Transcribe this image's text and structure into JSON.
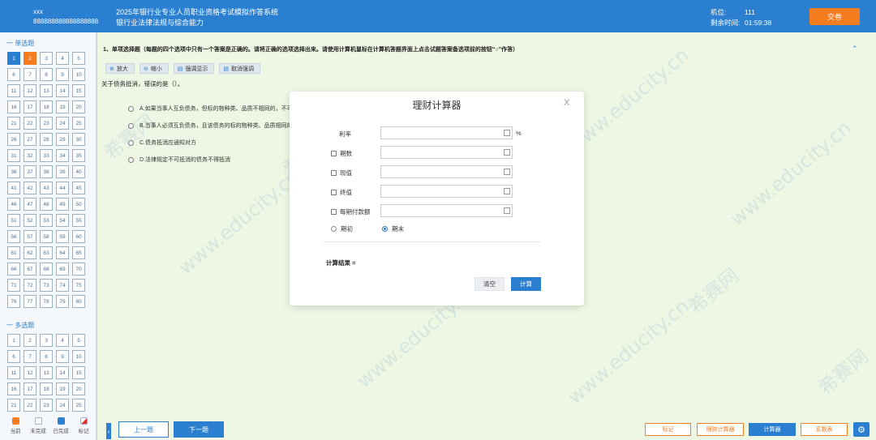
{
  "header": {
    "candidate_name": "xxx",
    "candidate_id": "888888888888888888",
    "exam_title": "2025年银行业专业人员职业资格考试模拟作答系统",
    "exam_subject": "银行业法律法规与综合能力",
    "seat_label": "机位:",
    "seat_value": "111",
    "time_label": "剩余时间:",
    "time_value": "01:59:38",
    "submit_label": "交卷"
  },
  "sidebar": {
    "single_title": "一 单选题",
    "multi_title": "一 多选题",
    "single_questions": [
      "1",
      "2",
      "3",
      "4",
      "5",
      "6",
      "7",
      "8",
      "9",
      "10",
      "11",
      "12",
      "13",
      "14",
      "15",
      "16",
      "17",
      "18",
      "19",
      "20",
      "21",
      "22",
      "23",
      "24",
      "25",
      "26",
      "27",
      "28",
      "29",
      "30",
      "31",
      "32",
      "33",
      "34",
      "35",
      "36",
      "37",
      "38",
      "39",
      "40",
      "41",
      "42",
      "43",
      "44",
      "45",
      "46",
      "47",
      "48",
      "49",
      "50",
      "51",
      "52",
      "53",
      "54",
      "55",
      "56",
      "57",
      "58",
      "59",
      "60",
      "61",
      "62",
      "63",
      "64",
      "65",
      "66",
      "67",
      "68",
      "69",
      "70",
      "71",
      "72",
      "73",
      "74",
      "75",
      "76",
      "77",
      "78",
      "79",
      "80"
    ],
    "multi_questions": [
      "1",
      "2",
      "3",
      "4",
      "5",
      "6",
      "7",
      "8",
      "9",
      "10",
      "11",
      "12",
      "13",
      "14",
      "15",
      "16",
      "17",
      "18",
      "19",
      "20",
      "21",
      "22",
      "23",
      "24",
      "25"
    ],
    "legend": [
      {
        "label": "当前",
        "color": "#f57c1f"
      },
      {
        "label": "未完成",
        "color": "#ffffff"
      },
      {
        "label": "已完成",
        "color": "#2a7fd0"
      },
      {
        "label": "标记",
        "color": "#e03030"
      }
    ]
  },
  "question": {
    "instruction": "1、单项选择题（每题的四个选项中只有一个答案是正确的。请将正确的选项选择出来。请使用计算机鼠标在计算机答题界面上点击试题答案备选项前的按钮“○”作答）",
    "stem": "关于债务抵消，错误的是（）。",
    "options": [
      "A.如果当事人互负债务，但标的物种类、品质不相同的，不可",
      "B.当事人必须互负债务，且该债务的标的物种类、品质相同的",
      "C.债务抵消应通知对方",
      "D.法律规定不可抵消的债务不得抵消"
    ]
  },
  "toolbar": {
    "zoom_in": "放大",
    "zoom_out": "缩小",
    "highlight": "强调显示",
    "cancel_highlight": "取消强调"
  },
  "navigation": {
    "prev": "上一题",
    "next": "下一题"
  },
  "bottom_buttons": {
    "mark": "标记",
    "fin_calc": "理财计算器",
    "calc": "计算器",
    "coef_table": "系数表"
  },
  "calculator": {
    "title": "理财计算器",
    "close": "X",
    "rate_label": "利率",
    "rate_unit": "%",
    "periods_label": "期数",
    "pv_label": "现值",
    "fv_label": "终值",
    "pmt_label": "每期付款额",
    "begin_label": "期初",
    "end_label": "期末",
    "result_label": "计算结果 =",
    "clear_label": "清空",
    "calc_label": "计算"
  },
  "watermark": {
    "brand": "希赛网",
    "url": "www.educity.cn"
  }
}
